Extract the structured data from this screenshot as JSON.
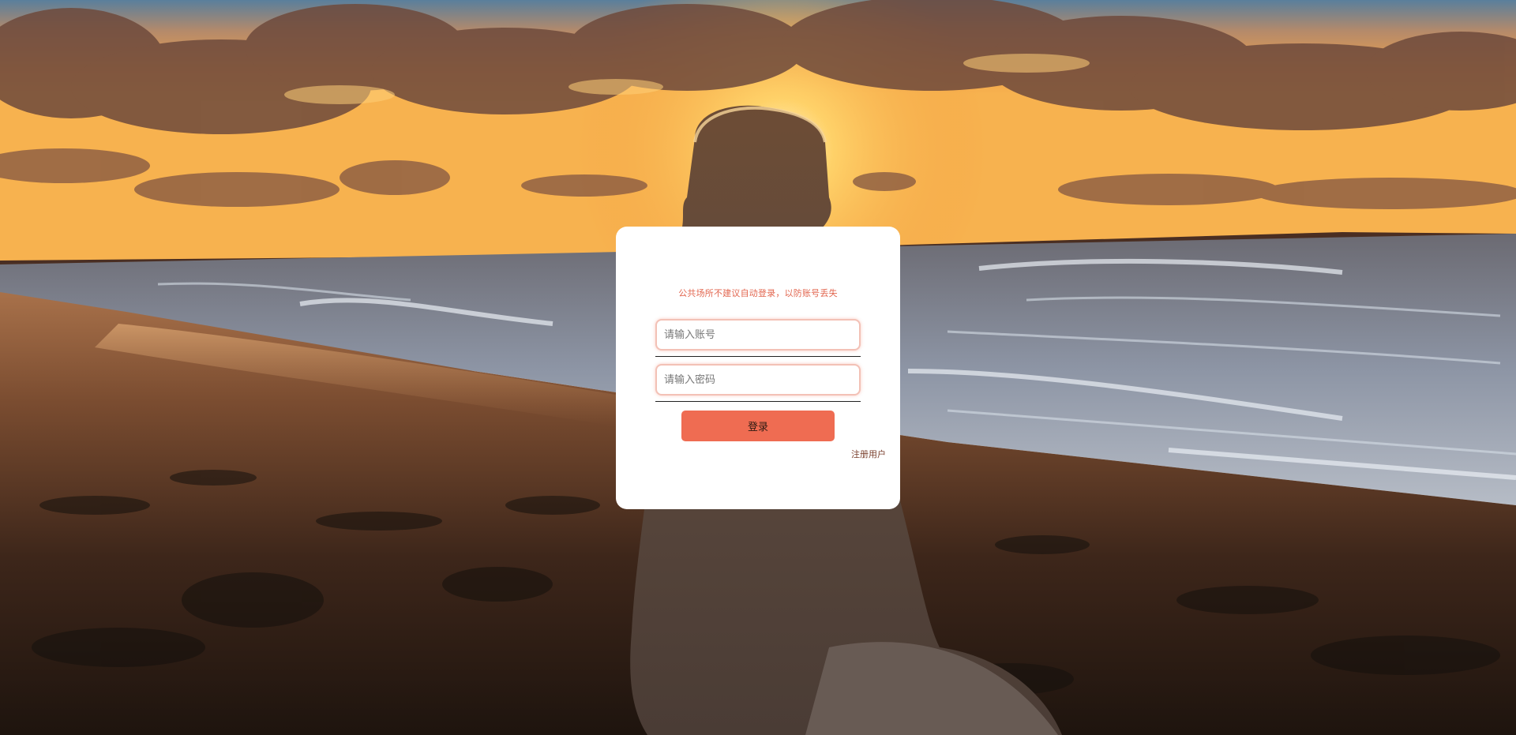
{
  "background": {
    "scene": "sunset-beach-dog",
    "sky_top": "#5a7f9c",
    "sun_glow": "#ffd36a",
    "sand_dark": "#1e140e"
  },
  "login": {
    "warning_text": "公共场所不建议自动登录，以防账号丢失",
    "account_placeholder": "请输入账号",
    "account_value": "",
    "password_placeholder": "请输入密码",
    "password_value": "",
    "login_button_label": "登录",
    "register_link_label": "注册用户",
    "accent_color": "#ef6c52"
  }
}
